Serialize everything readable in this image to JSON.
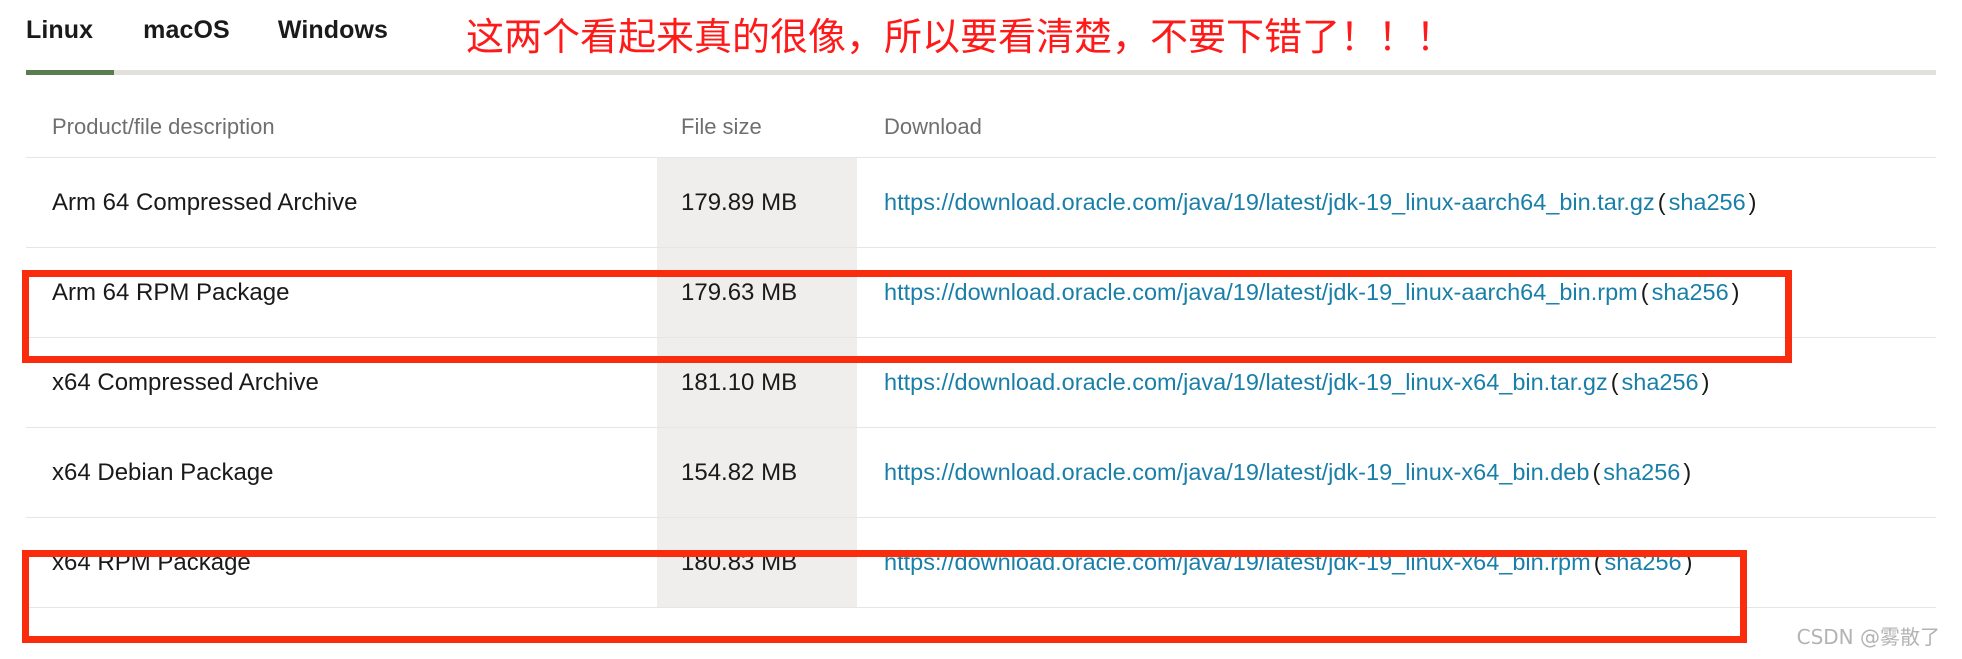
{
  "tabs": {
    "items": [
      {
        "label": "Linux",
        "active": true
      },
      {
        "label": "macOS",
        "active": false
      },
      {
        "label": "Windows",
        "active": false
      }
    ],
    "active_underline_color": "#5a7d4e",
    "track_color": "#e1e0da"
  },
  "annotation": {
    "text": "这两个看起来真的很像，所以要看清楚，不要下错了！！！",
    "color": "#ff1a1a"
  },
  "table": {
    "columns": [
      {
        "key": "description",
        "label": "Product/file description"
      },
      {
        "key": "filesize",
        "label": "File size"
      },
      {
        "key": "download",
        "label": "Download"
      }
    ],
    "size_column_background": "#efeeec",
    "link_color": "#1a7fa8",
    "rows": [
      {
        "description": "Arm 64 Compressed Archive",
        "filesize": "179.89 MB",
        "url": "https://download.oracle.com/java/19/latest/jdk-19_linux-aarch64_bin.tar.gz",
        "paren_open": "(",
        "checksum_label": "sha256",
        "paren_close": ")",
        "highlighted": false
      },
      {
        "description": "Arm 64 RPM Package",
        "filesize": "179.63 MB",
        "url": "https://download.oracle.com/java/19/latest/jdk-19_linux-aarch64_bin.rpm",
        "paren_open": "(",
        "checksum_label": "sha256",
        "paren_close": ")",
        "highlighted": true
      },
      {
        "description": "x64 Compressed Archive",
        "filesize": "181.10 MB",
        "url": "https://download.oracle.com/java/19/latest/jdk-19_linux-x64_bin.tar.gz",
        "paren_open": "(",
        "checksum_label": "sha256",
        "paren_close": ")",
        "highlighted": false
      },
      {
        "description": "x64 Debian Package",
        "filesize": "154.82 MB",
        "url": "https://download.oracle.com/java/19/latest/jdk-19_linux-x64_bin.deb",
        "paren_open": "(",
        "checksum_label": "sha256",
        "paren_close": ")",
        "highlighted": false
      },
      {
        "description": "x64 RPM Package",
        "filesize": "180.83 MB",
        "url": "https://download.oracle.com/java/19/latest/jdk-19_linux-x64_bin.rpm",
        "paren_open": "(",
        "checksum_label": "sha256",
        "paren_close": ")",
        "highlighted": true
      }
    ]
  },
  "highlight_boxes": {
    "color": "#f92d0e",
    "count": 2
  },
  "watermark": {
    "text": "CSDN @雾散了"
  }
}
